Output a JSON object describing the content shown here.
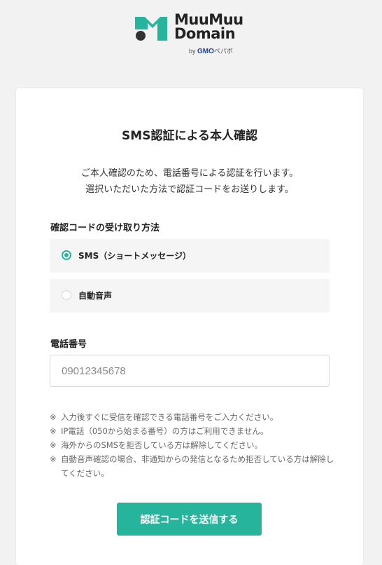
{
  "brand": {
    "line1": "MuuMuu",
    "line2": "Domain",
    "by": "by",
    "gmo": "GMO",
    "pepabo": "ペパボ",
    "accent": "#26b59c",
    "mark_dark": "#333333"
  },
  "page": {
    "title": "SMS認証による本人確認",
    "description": [
      "ご本人確認のため、電話番号による認証を行います。",
      "選択いただいた方法で認証コードをお送りします。"
    ]
  },
  "method": {
    "label": "確認コードの受け取り方法",
    "options": [
      {
        "label": "SMS（ショートメッセージ）",
        "selected": true
      },
      {
        "label": "自動音声",
        "selected": false
      }
    ]
  },
  "phone": {
    "label": "電話番号",
    "placeholder": "09012345678",
    "value": ""
  },
  "notes": [
    {
      "mark": "※",
      "text": "入力後すぐに受信を確認できる電話番号をご入力ください。"
    },
    {
      "mark": "※",
      "text": "IP電話（050から始まる番号）の方はご利用できません。"
    },
    {
      "mark": "※",
      "text": "海外からのSMSを拒否している方は解除してください。"
    },
    {
      "mark": "※",
      "text": "自動音声確認の場合、非通知からの発信となるため拒否している方は解除してください。"
    }
  ],
  "submit": {
    "label": "認証コードを送信する"
  }
}
